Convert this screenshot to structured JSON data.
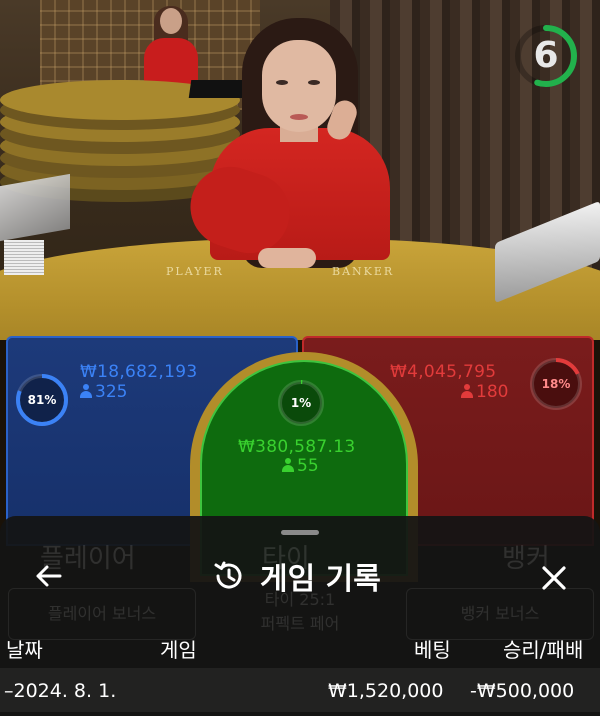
{
  "video": {
    "table_labels": [
      "PLAYER",
      "BANKER"
    ],
    "timer": {
      "seconds": "6",
      "remaining_fraction": 0.55,
      "color": "#22b14c"
    }
  },
  "bets": {
    "player": {
      "percent": "81%",
      "percent_value": 0.81,
      "amount": "₩18,682,193",
      "count": "325",
      "color": "#3b82f6"
    },
    "tie": {
      "percent": "1%",
      "percent_value": 0.01,
      "amount": "₩380,587.13",
      "count": "55",
      "color": "#39d12f"
    },
    "banker": {
      "percent": "18%",
      "percent_value": 0.18,
      "amount": "₩4,045,795",
      "count": "180",
      "color": "#e23b3b"
    }
  },
  "history": {
    "back_icon": "arrow-left-icon",
    "history_icon": "history-clock-icon",
    "title": "게임 기록",
    "close_icon": "close-icon",
    "ghost_labels": {
      "player": "플레이어",
      "tie": "타이",
      "banker": "뱅커",
      "player_bonus": "플레이어 보너스",
      "tie_payout": "타이 25:1",
      "perfect_pair": "퍼펙트 페어",
      "banker_bonus": "뱅커 보너스"
    },
    "columns": [
      "날짜",
      "게임",
      "베팅",
      "승리/패배"
    ],
    "rows": [
      {
        "date": "2024. 8. 1.",
        "game": "",
        "bet": "₩1,520,000",
        "result": "-₩500,000"
      }
    ]
  }
}
